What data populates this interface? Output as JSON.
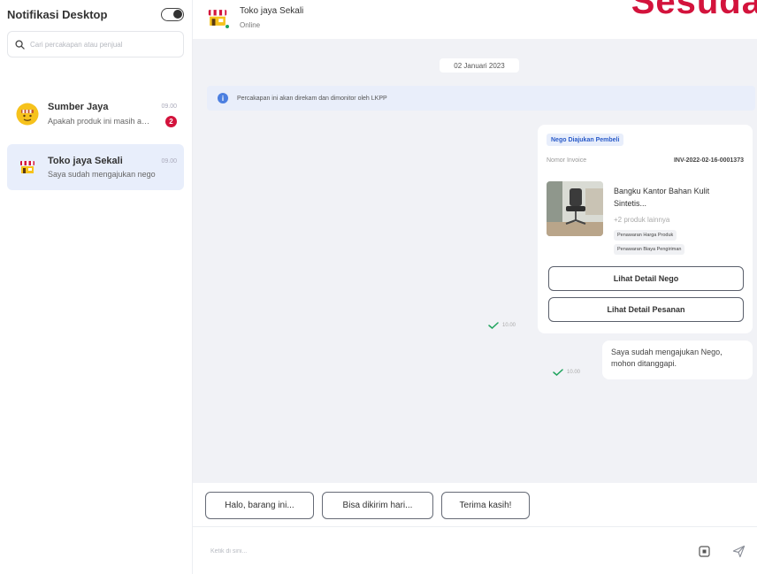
{
  "sidebar": {
    "notif_title": "Notifikasi Desktop",
    "search_placeholder": "Cari percakapan atau penjual",
    "conversations": [
      {
        "name": "Sumber Jaya",
        "time": "09.00",
        "preview": "Apakah produk ini masih ada?",
        "badge": "2"
      },
      {
        "name": "Toko jaya Sekali",
        "time": "09.00",
        "preview": "Saya sudah mengajukan nego",
        "badge": ""
      }
    ]
  },
  "header": {
    "store_name": "Toko jaya Sekali",
    "status": "Online",
    "brand_text": "Sesuda"
  },
  "chat": {
    "date": "02 Januari 2023",
    "info": "Percakapan ini akan direkam dan dimonitor oleh LKPP",
    "nego_card": {
      "tag": "Nego Diajukan Pembeli",
      "invoice_label": "Nomor Invoice",
      "invoice_value": "INV-2022-02-16-0001373",
      "product_name": "Bangku Kantor Bahan Kulit Sintetis...",
      "more_products": "+2 produk lainnya",
      "chips": [
        "Penawaran Harga Produk",
        "Penawaran Biaya Pengiriman"
      ],
      "btn_nego": "Lihat Detail Nego",
      "btn_order": "Lihat Detail Pesanan",
      "time": "10.00"
    },
    "text_message": {
      "text": "Saya sudah mengajukan Nego, mohon ditanggapi.",
      "time": "10.00"
    }
  },
  "quick_replies": [
    "Halo, barang ini...",
    "Bisa dikirim hari...",
    "Terima kasih!"
  ],
  "composer": {
    "placeholder": "Ketik di sini..."
  },
  "colors": {
    "brand_red": "#d3133c",
    "active_bg": "#e8eefb",
    "chat_bg": "#f1f2f6",
    "check_green": "#1ea35c"
  }
}
